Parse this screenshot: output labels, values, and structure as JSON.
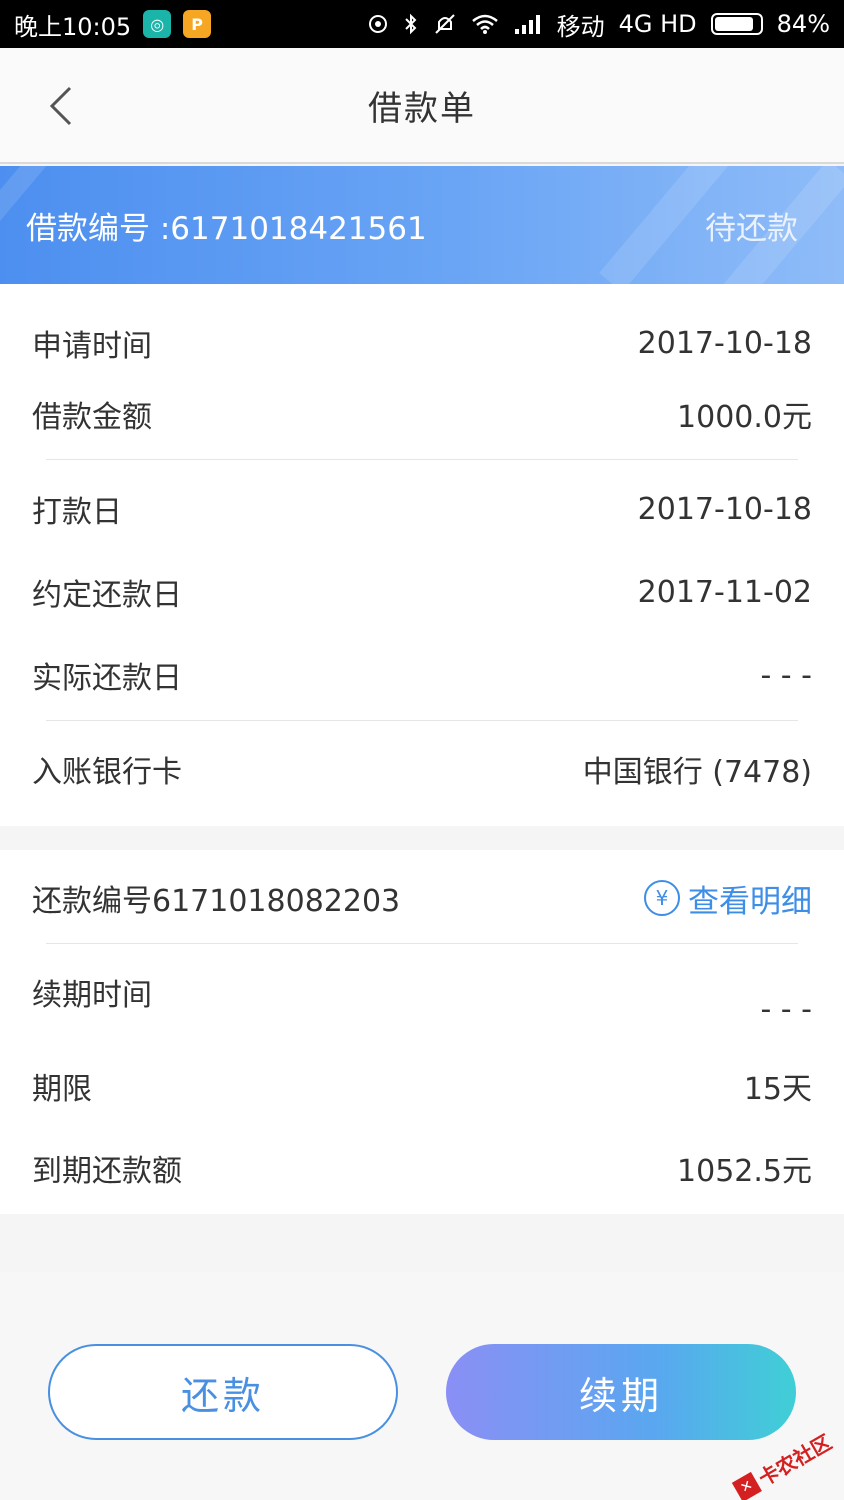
{
  "status_bar": {
    "time": "晚上10:05",
    "carrier": "移动",
    "network": "4G HD",
    "battery": "84%"
  },
  "nav": {
    "title": "借款单"
  },
  "banner": {
    "loan_no": "借款编号 :6171018421561",
    "status": "待还款"
  },
  "loan": {
    "rows": [
      {
        "label": "申请时间",
        "value": "2017-10-18"
      },
      {
        "label": "借款金额",
        "value": "1000.0元"
      },
      {
        "label": "打款日",
        "value": "2017-10-18"
      },
      {
        "label": "约定还款日",
        "value": "2017-11-02"
      },
      {
        "label": "实际还款日",
        "value": "- - -"
      },
      {
        "label": "入账银行卡",
        "value": "中国银行 (7478)"
      }
    ]
  },
  "repayment": {
    "repay_no": "还款编号6171018082203",
    "detail_icon": "¥",
    "detail_link": "查看明细",
    "rows": [
      {
        "label": "续期时间",
        "value": "- - -"
      },
      {
        "label": "期限",
        "value": "15天"
      },
      {
        "label": "到期还款额",
        "value": "1052.5元"
      }
    ]
  },
  "buttons": {
    "repay": "还款",
    "renew": "续期"
  },
  "watermark": "卡农社区",
  "colors": {
    "accent": "#4a90e2",
    "banner_start": "#4d8ff0",
    "banner_end": "#8fbcf8",
    "renew_start": "#8a8ff5",
    "renew_end": "#3fcfd6"
  }
}
